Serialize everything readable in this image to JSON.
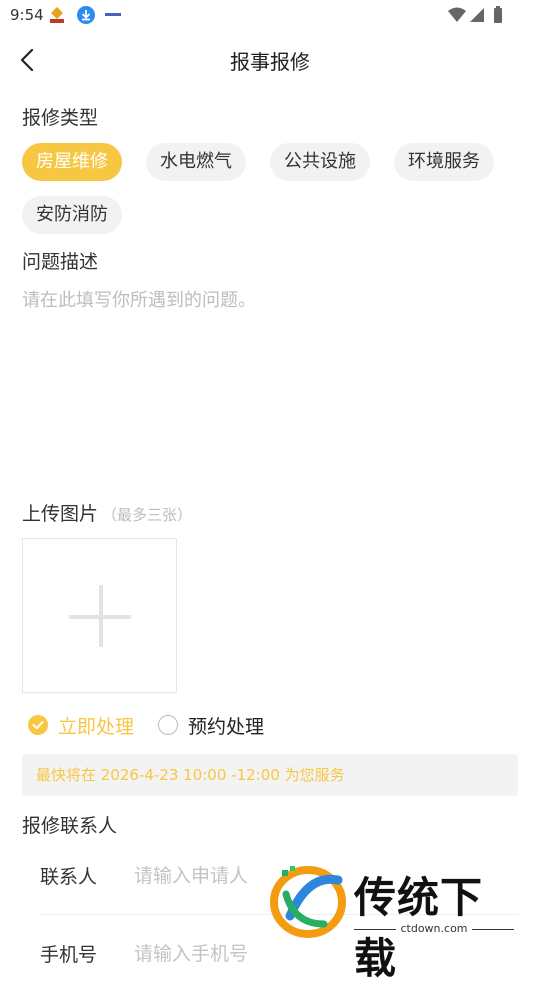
{
  "status_bar": {
    "time": "9:54"
  },
  "header": {
    "title": "报事报修"
  },
  "repair_type": {
    "label": "报修类型",
    "options": [
      "房屋维修",
      "水电燃气",
      "公共设施",
      "环境服务",
      "安防消防"
    ],
    "selected": "房屋维修"
  },
  "description": {
    "label": "问题描述",
    "placeholder": "请在此填写你所遇到的问题。"
  },
  "upload": {
    "label": "上传图片",
    "hint": "（最多三张）"
  },
  "processing": {
    "options": [
      {
        "label": "立即处理",
        "selected": true
      },
      {
        "label": "预约处理",
        "selected": false
      }
    ],
    "notice": "最快将在 2026-4-23 10:00 -12:00 为您服务"
  },
  "contact": {
    "section_label": "报修联系人",
    "name_label": "联系人",
    "name_placeholder": "请输入申请人",
    "phone_label": "手机号",
    "phone_placeholder": "请输入手机号"
  },
  "watermark": {
    "text": "传统下载",
    "url": "ctdown.com"
  },
  "colors": {
    "accent": "#f7c744",
    "chip_bg": "#f2f2f2",
    "placeholder": "#bdbdbd"
  }
}
